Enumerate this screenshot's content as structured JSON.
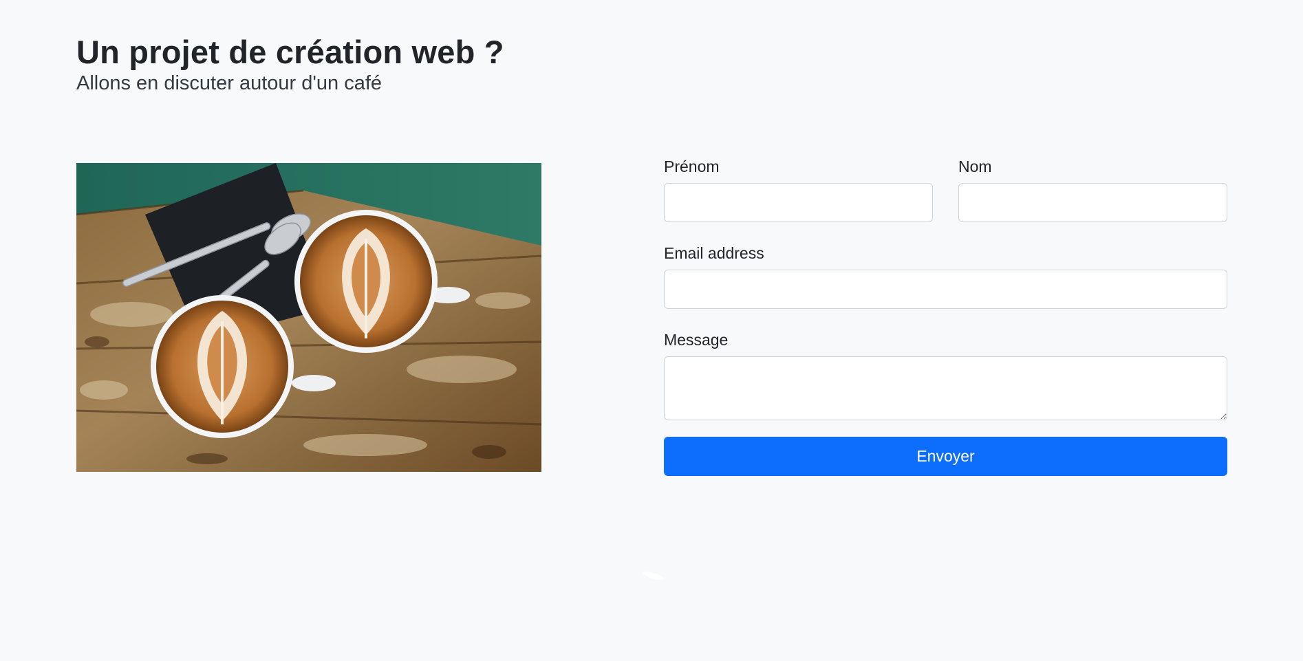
{
  "header": {
    "title": "Un projet de création web ?",
    "subtitle": "Allons en discuter autour d'un café"
  },
  "image": {
    "subject": "two latte art coffee cups with spoons on a weathered wooden table"
  },
  "form": {
    "first_name": {
      "label": "Prénom",
      "value": ""
    },
    "last_name": {
      "label": "Nom",
      "value": ""
    },
    "email": {
      "label": "Email address",
      "value": ""
    },
    "message": {
      "label": "Message",
      "value": ""
    },
    "submit_label": "Envoyer"
  },
  "colors": {
    "background": "#f8f9fa",
    "primary": "#0d6efd",
    "text": "#212529",
    "input_border": "#ced4da"
  }
}
